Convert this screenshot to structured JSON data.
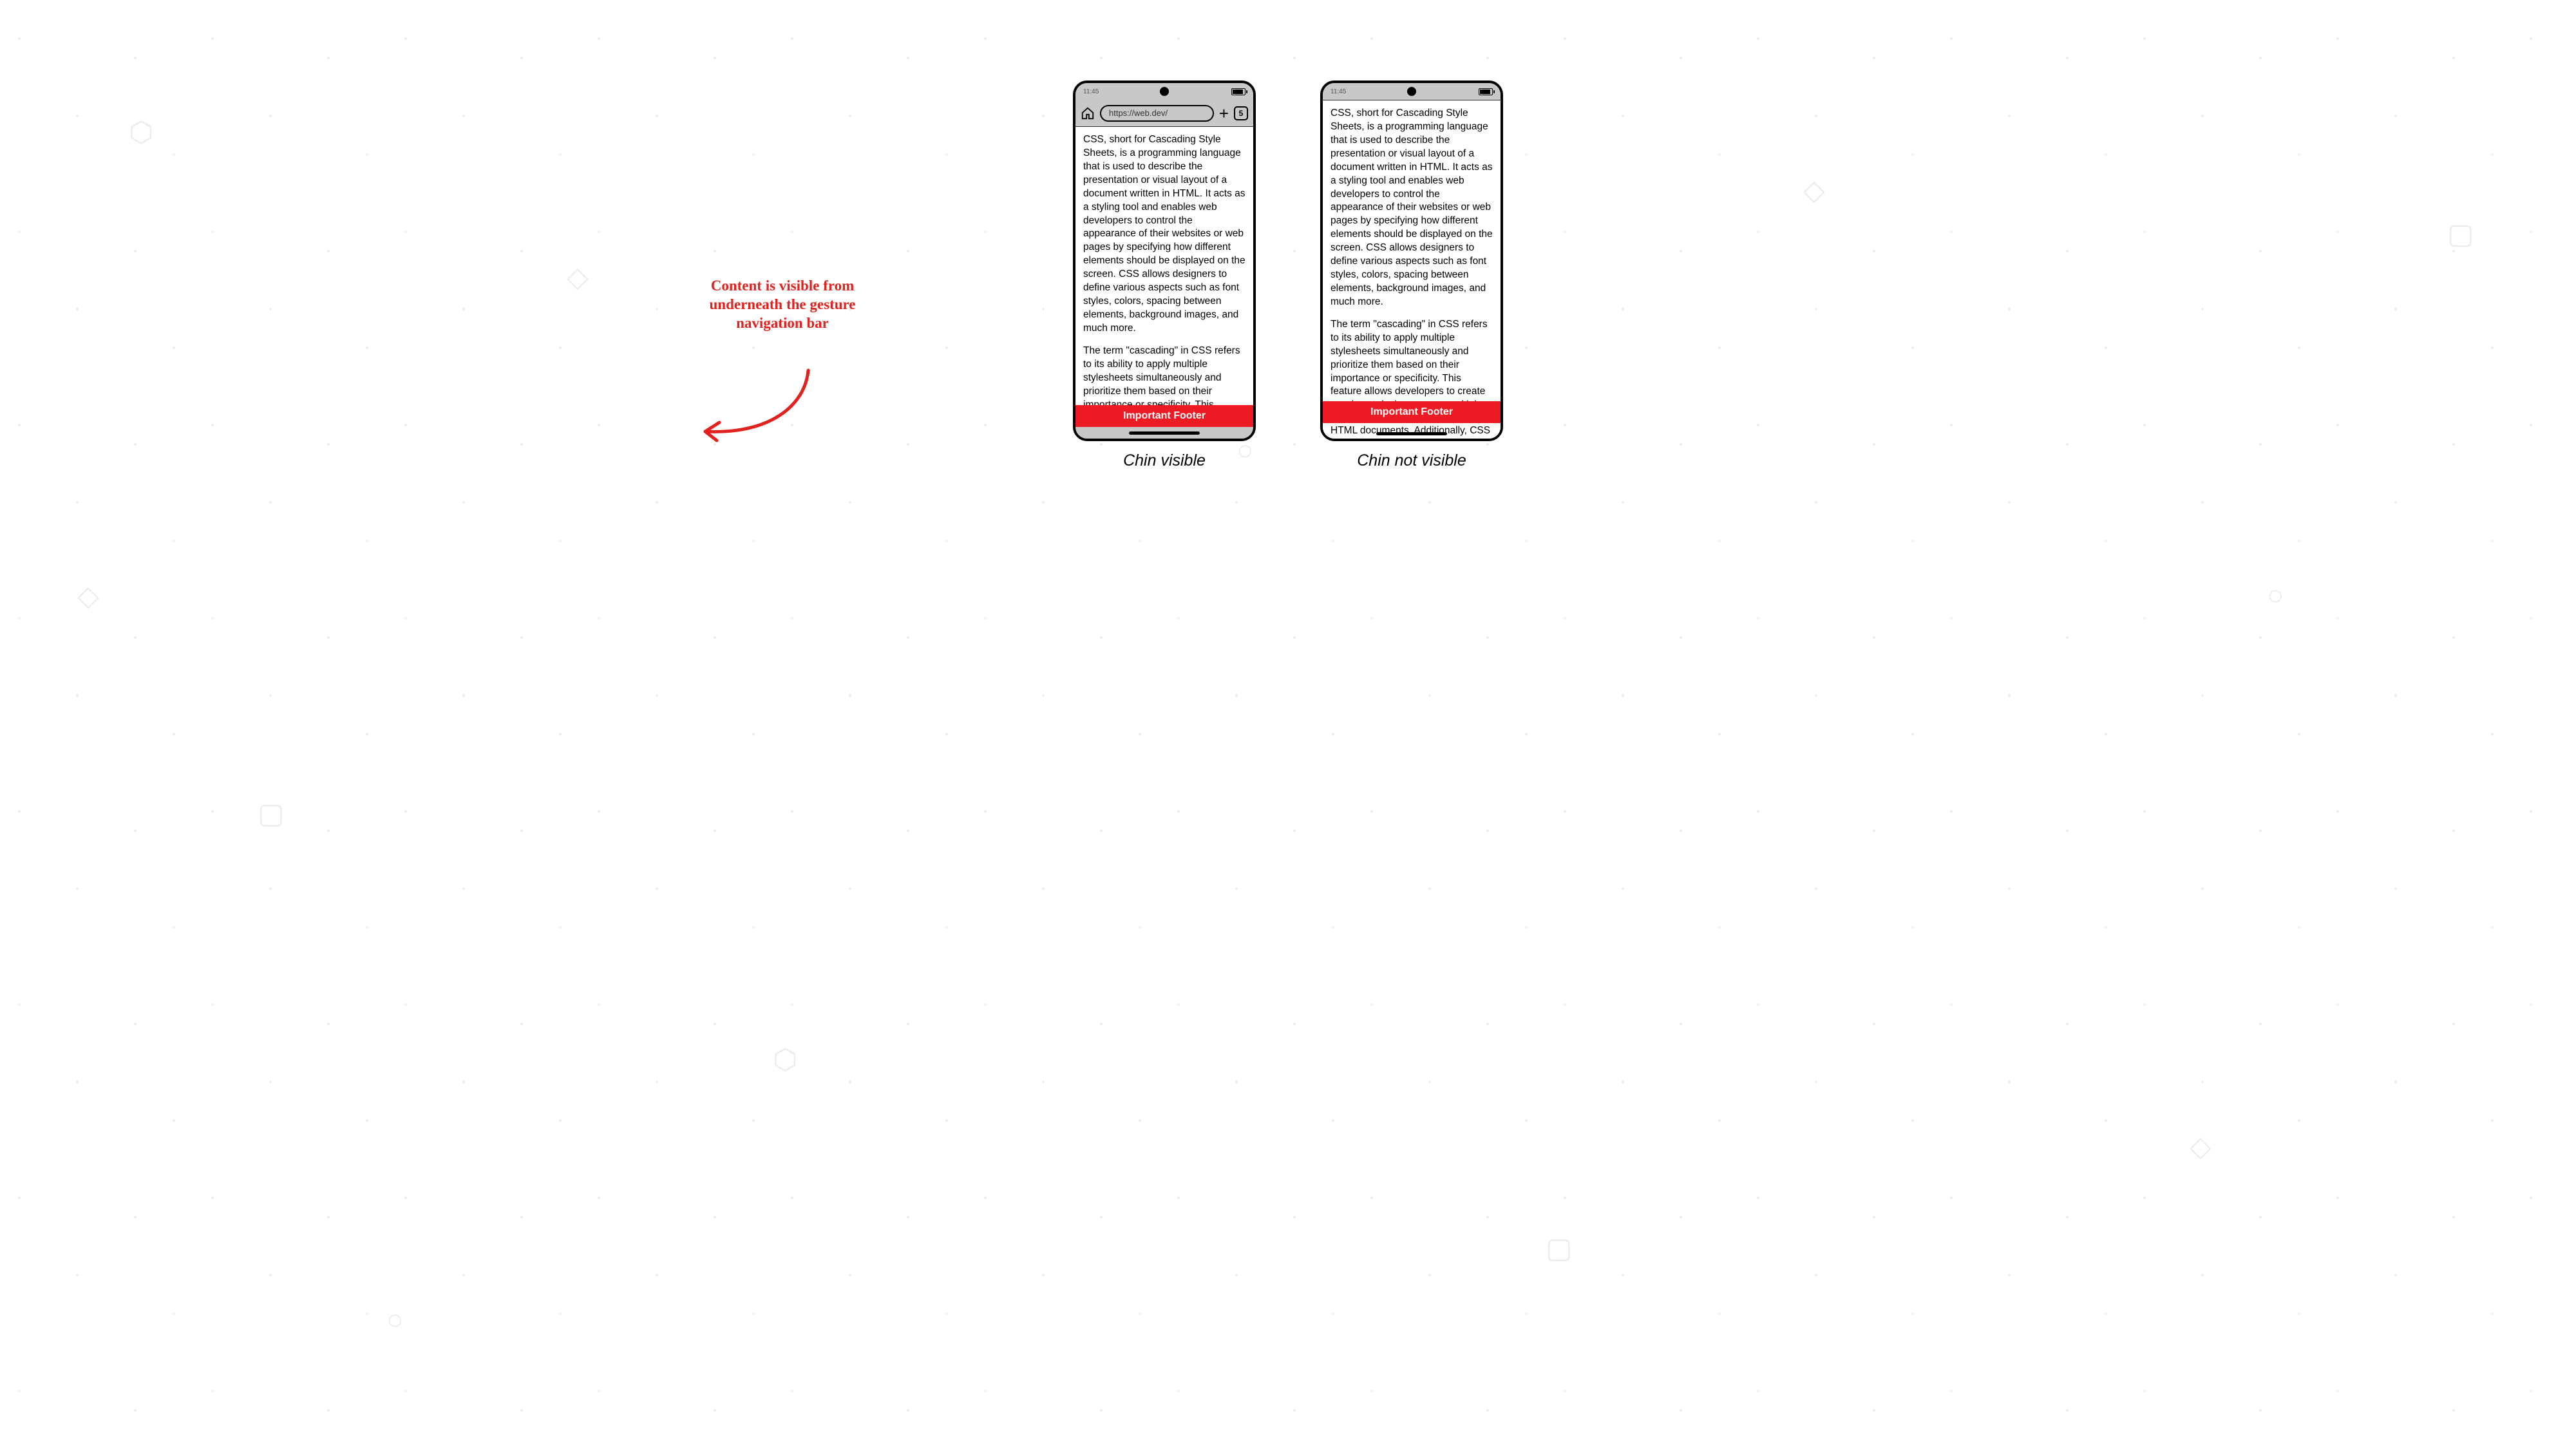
{
  "statusbar": {
    "time": "11:45"
  },
  "urlbar": {
    "url": "https://web.dev/",
    "tab_count": "5"
  },
  "content": {
    "para1": "CSS, short for Cascading Style Sheets, is a programming language that is used to describe the presentation or visual layout of a document written in HTML. It acts as a styling tool and enables web developers to control the appearance of their websites or web pages by specifying how different elements should be displayed on the screen. CSS allows designers to define various aspects such as font styles, colors, spacing between elements, background images, and much more.",
    "para2_a": "The term \"cascading\" in CSS refers to its ability to apply multiple stylesheets simultaneously and prioritize them based on their importance or specificity. This feature allows developers to create",
    "para2_b": "The term \"cascading\" in CSS refers to its ability to apply multiple stylesheets simultaneously and prioritize them based on their importance or specificity. This feature allows developers to create consistent designs across multiple web pages by defining common",
    "below_footer_b": "HTML documents. Additionally, CSS"
  },
  "footer": {
    "label": "Important Footer"
  },
  "captions": {
    "a": "Chin visible",
    "b": "Chin not visible"
  },
  "annotation": {
    "text": "Content is visible from underneath the gesture navigation bar"
  },
  "colors": {
    "accent_red": "#ed1c24",
    "annotation_red": "#e2221f"
  }
}
